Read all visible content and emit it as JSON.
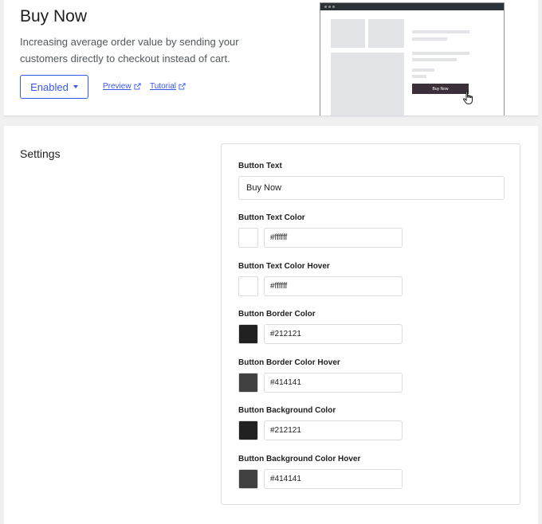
{
  "header": {
    "title": "Buy Now",
    "description": "Increasing average order value by sending your customers directly to checkout instead of cart.",
    "status_label": "Enabled",
    "preview_label": "Preview",
    "tutorial_label": "Tutorial",
    "illustration_button_label": "Buy Now"
  },
  "settings": {
    "title": "Settings",
    "button_text": {
      "label": "Button Text",
      "value": "Buy Now"
    },
    "colors": [
      {
        "label": "Button Text Color",
        "value": "#ffffff",
        "color": "#ffffff"
      },
      {
        "label": "Button Text Color Hover",
        "value": "#ffffff",
        "color": "#ffffff"
      },
      {
        "label": "Button Border Color",
        "value": "#212121",
        "color": "#212121"
      },
      {
        "label": "Button Border Color Hover",
        "value": "#414141",
        "color": "#414141"
      },
      {
        "label": "Button Background Color",
        "value": "#212121",
        "color": "#212121"
      },
      {
        "label": "Button Background Color Hover",
        "value": "#414141",
        "color": "#414141"
      }
    ]
  },
  "theme": {
    "accent": "#3858e9"
  }
}
